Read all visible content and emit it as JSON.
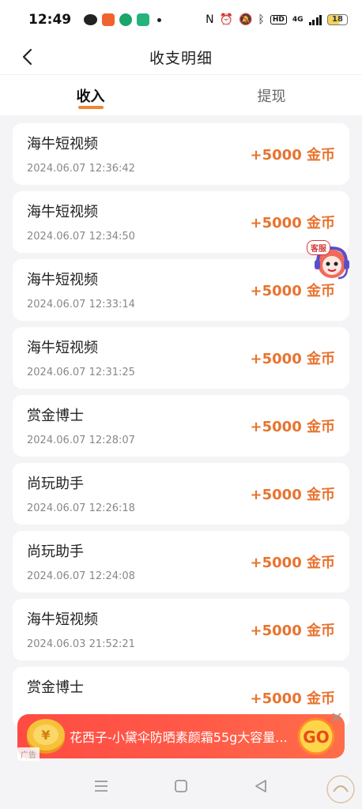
{
  "status_bar": {
    "time": "12:49",
    "network": "4G",
    "battery": "18"
  },
  "header": {
    "title": "收支明细"
  },
  "tabs": [
    {
      "label": "收入",
      "active": true
    },
    {
      "label": "提现",
      "active": false
    }
  ],
  "records": [
    {
      "source": "海牛短视频",
      "time": "2024.06.07 12:36:42",
      "amount": "+5000 金币"
    },
    {
      "source": "海牛短视频",
      "time": "2024.06.07 12:34:50",
      "amount": "+5000 金币"
    },
    {
      "source": "海牛短视频",
      "time": "2024.06.07 12:33:14",
      "amount": "+5000 金币"
    },
    {
      "source": "海牛短视频",
      "time": "2024.06.07 12:31:25",
      "amount": "+5000 金币"
    },
    {
      "source": "赏金博士",
      "time": "2024.06.07 12:28:07",
      "amount": "+5000 金币"
    },
    {
      "source": "尚玩助手",
      "time": "2024.06.07 12:26:18",
      "amount": "+5000 金币"
    },
    {
      "source": "尚玩助手",
      "time": "2024.06.07 12:24:08",
      "amount": "+5000 金币"
    },
    {
      "source": "海牛短视频",
      "time": "2024.06.03 21:52:21",
      "amount": "+5000 金币"
    },
    {
      "source": "赏金博士",
      "time": "",
      "amount": "+5000 金币"
    }
  ],
  "floating": {
    "cs_label": "客服"
  },
  "ad": {
    "text": "花西子-小黛伞防晒素颜霜55g大容量...",
    "cta": "GO",
    "tag": "广告"
  },
  "colors": {
    "accent": "#f0862f",
    "amount": "#e8732f",
    "ad_bg": "#ff4b43"
  }
}
